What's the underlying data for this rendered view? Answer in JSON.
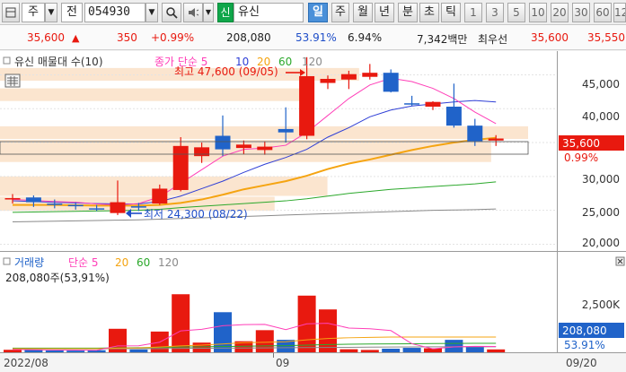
{
  "toolbar": {
    "type_label": "주",
    "type_label2": "전",
    "code": "054930",
    "name_tag": "신",
    "name": "유신",
    "periods": [
      "일",
      "주",
      "월",
      "년",
      "분",
      "초",
      "틱"
    ],
    "active_period": "일",
    "minutes": [
      "1",
      "3",
      "5",
      "10",
      "20",
      "30",
      "60",
      "12"
    ]
  },
  "quote": {
    "price": "35,600",
    "change": "350",
    "change_pct": "+0.99%",
    "volume": "208,080",
    "vol_ratio": "53.91%",
    "turnover": "6.94%",
    "amount": "7,342백만",
    "ask_label": "최우선",
    "ask1": "35,600",
    "ask2": "35,550"
  },
  "price_panel": {
    "title": "유신 매물대 수(10)",
    "ma_title": "종가 단순 5",
    "ma_periods": [
      "10",
      "20",
      "60",
      "120"
    ],
    "high_label": "최고 47,600 (09/05)",
    "low_label": "최저 24,300 (08/22)",
    "price_tag": "35,600",
    "pct_tag": "0.99%",
    "y_ticks": [
      "45,000",
      "40,000",
      "35,000",
      "30,000",
      "25,000",
      "20,000"
    ]
  },
  "volume_panel": {
    "title": "거래량",
    "ma_title": "단순 5",
    "ma_periods": [
      "20",
      "60",
      "120"
    ],
    "info": "208,080주(53,91%)",
    "y_tick": "2,500K",
    "vol_tag": "208,080",
    "pct_tag": "53.91%"
  },
  "x_labels": [
    "2022/08",
    "09",
    "09/20"
  ],
  "chart_data": {
    "type": "candlestick",
    "ylim": [
      19000,
      48500
    ],
    "vol_ylim": [
      0,
      4800
    ],
    "colors": {
      "up": "#e8190f",
      "down": "#2063c9",
      "ma5": "#ff3fb8",
      "ma10": "#2f3fd6",
      "ma20": "#f5a411",
      "ma60": "#2ba82b",
      "ma120": "#8a8a8a"
    },
    "candles": [
      {
        "o": 26800,
        "h": 27400,
        "l": 26000,
        "c": 26800,
        "v": 180
      },
      {
        "o": 26900,
        "h": 27200,
        "l": 25500,
        "c": 26200,
        "v": 160
      },
      {
        "o": 26000,
        "h": 26600,
        "l": 25300,
        "c": 25900,
        "v": 130
      },
      {
        "o": 25800,
        "h": 26200,
        "l": 25100,
        "c": 25600,
        "v": 120
      },
      {
        "o": 25300,
        "h": 25800,
        "l": 24900,
        "c": 25200,
        "v": 150
      },
      {
        "o": 24600,
        "h": 29400,
        "l": 24300,
        "c": 26200,
        "v": 1700
      },
      {
        "o": 25600,
        "h": 26100,
        "l": 24900,
        "c": 25400,
        "v": 200
      },
      {
        "o": 26000,
        "h": 28800,
        "l": 25800,
        "c": 28200,
        "v": 1500
      },
      {
        "o": 28000,
        "h": 35800,
        "l": 27800,
        "c": 34500,
        "v": 4200
      },
      {
        "o": 33000,
        "h": 35000,
        "l": 32000,
        "c": 34300,
        "v": 700
      },
      {
        "o": 36000,
        "h": 39000,
        "l": 33000,
        "c": 34000,
        "v": 2900
      },
      {
        "o": 34200,
        "h": 35300,
        "l": 33300,
        "c": 34700,
        "v": 800
      },
      {
        "o": 33900,
        "h": 35200,
        "l": 33200,
        "c": 34400,
        "v": 1600
      },
      {
        "o": 37000,
        "h": 40200,
        "l": 35000,
        "c": 36500,
        "v": 900
      },
      {
        "o": 36000,
        "h": 47600,
        "l": 35500,
        "c": 44800,
        "v": 4100
      },
      {
        "o": 43800,
        "h": 44900,
        "l": 42900,
        "c": 44400,
        "v": 3100
      },
      {
        "o": 44300,
        "h": 45600,
        "l": 42900,
        "c": 45100,
        "v": 220
      },
      {
        "o": 44700,
        "h": 46600,
        "l": 44300,
        "c": 45300,
        "v": 170
      },
      {
        "o": 45300,
        "h": 45800,
        "l": 42400,
        "c": 42500,
        "v": 260
      },
      {
        "o": 40800,
        "h": 41900,
        "l": 40400,
        "c": 40700,
        "v": 320
      },
      {
        "o": 40300,
        "h": 41100,
        "l": 39800,
        "c": 41000,
        "v": 290
      },
      {
        "o": 40300,
        "h": 43700,
        "l": 37200,
        "c": 37500,
        "v": 900
      },
      {
        "o": 37500,
        "h": 38500,
        "l": 34500,
        "c": 35200,
        "v": 400
      },
      {
        "o": 35300,
        "h": 36100,
        "l": 34500,
        "c": 35600,
        "v": 208
      }
    ],
    "ma5": [
      26600,
      26450,
      26300,
      26200,
      25950,
      25800,
      26000,
      27000,
      29000,
      31000,
      33000,
      34000,
      34200,
      34600,
      36500,
      39000,
      41500,
      43500,
      44500,
      44000,
      43000,
      41500,
      39500,
      37800
    ],
    "ma10": [
      26400,
      26300,
      26200,
      26100,
      26000,
      25950,
      25950,
      26300,
      27100,
      28200,
      29300,
      30600,
      31800,
      32800,
      34000,
      35800,
      37200,
      38800,
      39800,
      40400,
      40700,
      41000,
      41200,
      41000
    ],
    "ma20": [
      25800,
      25800,
      25800,
      25750,
      25700,
      25700,
      25700,
      25800,
      26100,
      26600,
      27300,
      28100,
      28700,
      29300,
      30100,
      31100,
      31900,
      32500,
      33200,
      33900,
      34500,
      35000,
      35400,
      35700
    ],
    "ma60": [
      24700,
      24750,
      24800,
      24850,
      24900,
      24950,
      25000,
      25150,
      25400,
      25600,
      25800,
      26000,
      26200,
      26400,
      26700,
      27100,
      27500,
      27800,
      28100,
      28300,
      28500,
      28700,
      28900,
      29200
    ],
    "ma120": [
      23300,
      23350,
      23400,
      23450,
      23500,
      23550,
      23600,
      23700,
      23800,
      23900,
      24000,
      24100,
      24200,
      24300,
      24400,
      24500,
      24600,
      24700,
      24800,
      24900,
      25000,
      25050,
      25100,
      25200
    ],
    "vol_ma5": [
      200,
      190,
      170,
      160,
      150,
      460,
      470,
      730,
      1550,
      1660,
      1920,
      2000,
      2020,
      1640,
      2060,
      2100,
      1750,
      1700,
      1570,
      620,
      250,
      390,
      430,
      420
    ],
    "vol_ma20": [
      260,
      260,
      260,
      260,
      260,
      300,
      320,
      380,
      460,
      520,
      600,
      700,
      720,
      760,
      900,
      1000,
      1050,
      1080,
      1100,
      1100,
      1100,
      1100,
      1100,
      1100
    ],
    "vol_ma60": [
      300,
      300,
      300,
      300,
      300,
      320,
      330,
      350,
      380,
      400,
      420,
      440,
      460,
      480,
      520,
      560,
      580,
      600,
      610,
      620,
      630,
      640,
      650,
      650
    ],
    "vol_ma120": [
      250,
      250,
      250,
      250,
      250,
      260,
      260,
      270,
      280,
      290,
      300,
      310,
      320,
      330,
      340,
      350,
      360,
      370,
      380,
      390,
      400,
      400,
      400,
      400
    ],
    "volume_profile": [
      {
        "from": 44000,
        "to": 46000,
        "w": 0.68
      },
      {
        "from": 41000,
        "to": 43000,
        "w": 0.58
      },
      {
        "from": 35400,
        "to": 37400,
        "w": 1.0
      },
      {
        "from": 32000,
        "to": 35400,
        "w": 0.93
      },
      {
        "from": 27000,
        "to": 30000,
        "w": 0.62
      },
      {
        "from": 24800,
        "to": 27000,
        "w": 0.52
      }
    ]
  }
}
